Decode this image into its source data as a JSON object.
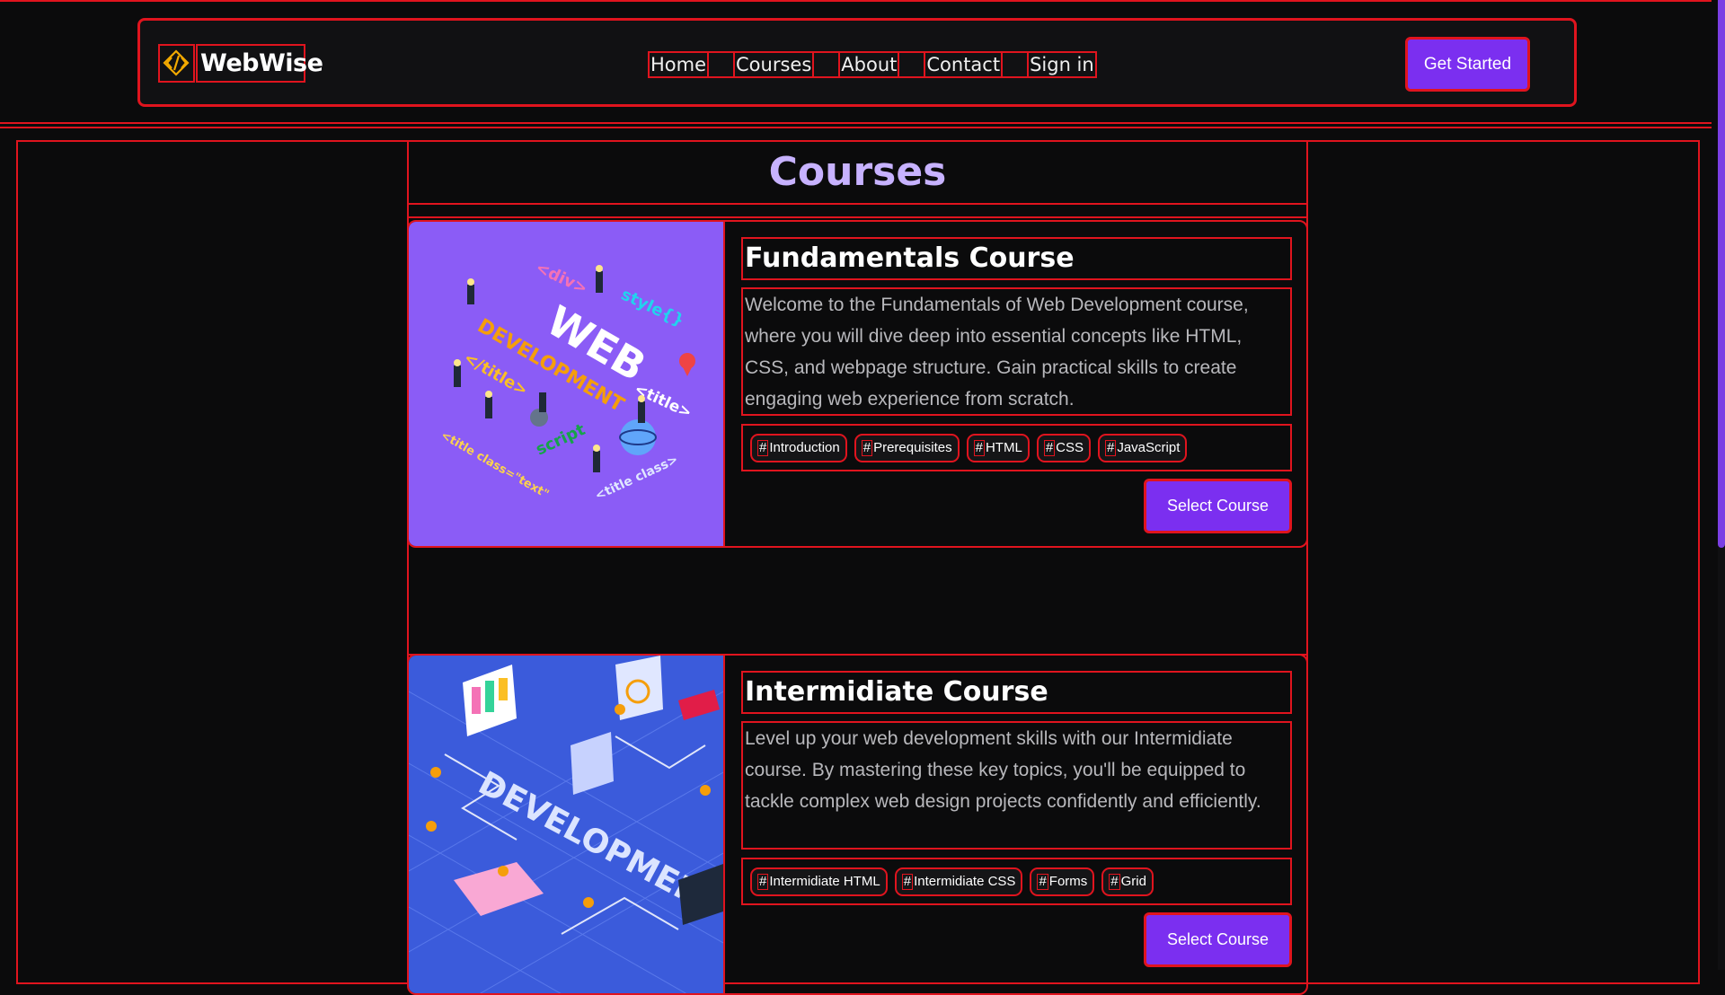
{
  "brand": {
    "name": "WebWise"
  },
  "nav": {
    "items": [
      "Home",
      "Courses",
      "About",
      "Contact",
      "Sign in"
    ]
  },
  "header": {
    "cta": "Get Started"
  },
  "page": {
    "title": "Courses"
  },
  "courses": [
    {
      "title": "Fundamentals Course",
      "description": "Welcome to the Fundamentals of Web Development course, where you will dive deep into essential concepts like HTML, CSS, and webpage structure. Gain practical skills to create engaging web experience from scratch.",
      "tags": [
        "Introduction",
        "Prerequisites",
        "HTML",
        "CSS",
        "JavaScript"
      ],
      "button": "Select Course"
    },
    {
      "title": "Intermidiate Course",
      "description": "Level up your web development skills with our Intermidiate course. By mastering these key topics, you'll be equipped to tackle complex web design projects confidently and efficiently.",
      "tags": [
        "Intermidiate HTML",
        "Intermidiate CSS",
        "Forms",
        "Grid"
      ],
      "button": "Select Course"
    }
  ],
  "tag_prefix": "#",
  "colors": {
    "accent": "#7b2ff0",
    "title": "#c7b2ff",
    "debug_outline": "#e0141e",
    "bg": "#0b0b0c"
  },
  "illustrations": {
    "course1": {
      "texts": [
        "WEB",
        "DEVELOPMENT",
        "<div>",
        "style{}",
        "</title>",
        "<title>",
        "script",
        "<title class=\"text\"",
        "<title class>"
      ]
    },
    "course2": {
      "texts": [
        "DEVELOPMENT"
      ]
    }
  }
}
